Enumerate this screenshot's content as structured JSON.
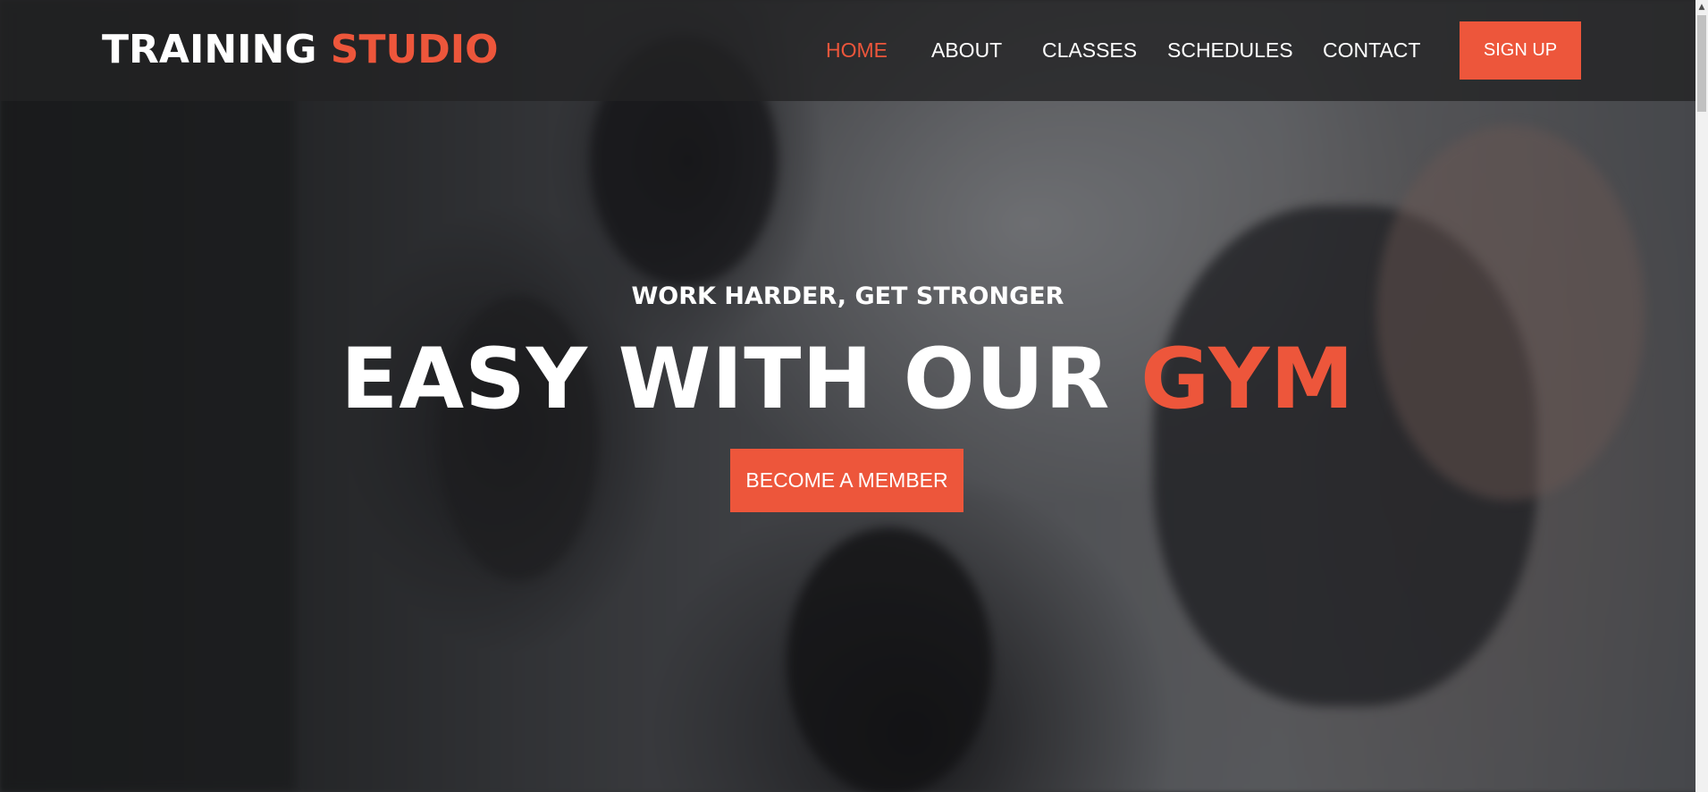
{
  "brand": {
    "name_part1": "TRAINING",
    "name_part2": "STUDIO",
    "accent_color": "#ed563b"
  },
  "nav": {
    "items": [
      {
        "label": "HOME",
        "active": true
      },
      {
        "label": "ABOUT",
        "active": false
      },
      {
        "label": "CLASSES",
        "active": false
      },
      {
        "label": "SCHEDULES",
        "active": false
      },
      {
        "label": "CONTACT",
        "active": false
      }
    ],
    "signup_label": "SIGN UP"
  },
  "hero": {
    "tagline": "WORK HARDER, GET STRONGER",
    "headline_part1": "EASY WITH OUR",
    "headline_part2": "GYM",
    "cta_label": "BECOME A MEMBER",
    "background_image": "gym-photo"
  },
  "colors": {
    "header_bg": "#232324",
    "text": "#ffffff",
    "accent": "#ed563b"
  }
}
